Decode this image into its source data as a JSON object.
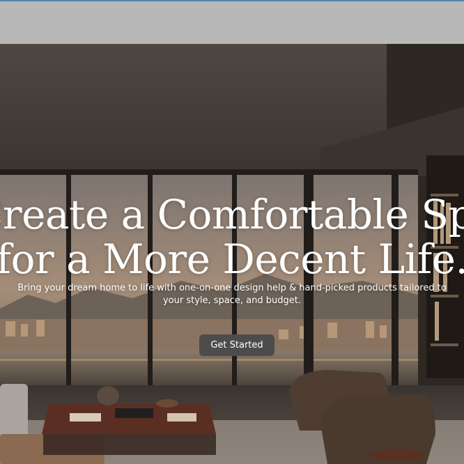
{
  "hero": {
    "headline_line1": "Create a Comfortable Space",
    "headline_line2": "for a More Decent Life.",
    "subtitle": "Bring your dream home to life with one-on-one design help & hand-picked products tailored to your style, space, and budget.",
    "cta_label": "Get Started"
  }
}
